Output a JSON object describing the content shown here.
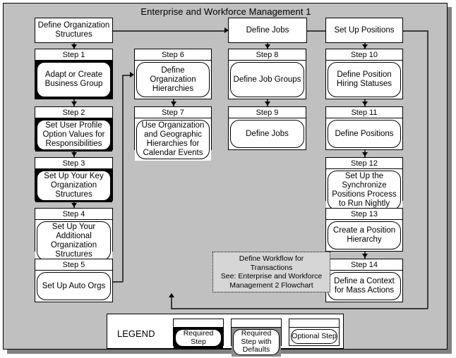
{
  "diagram": {
    "title": "Enterprise and Workforce Management 1",
    "top_row": [
      {
        "id": "define-org-structures",
        "label": "Define Organization Structures"
      },
      {
        "id": "define-jobs",
        "label": "Define Jobs"
      },
      {
        "id": "set-up-positions",
        "label": "Set Up Positions"
      }
    ],
    "steps": [
      {
        "id": "step-1",
        "header": "Step 1",
        "label": "Adapt or Create Business Group",
        "style": "required"
      },
      {
        "id": "step-2",
        "header": "Step 2",
        "label": "Set User Profile Option Values for Responsibilities",
        "style": "required"
      },
      {
        "id": "step-3",
        "header": "Step 3",
        "label": "Set Up Your Key Organization Structures",
        "style": "required"
      },
      {
        "id": "step-4",
        "header": "Step 4",
        "label": "Set Up Your Additional Organization Structures",
        "style": "optional"
      },
      {
        "id": "step-5",
        "header": "Step 5",
        "label": "Set Up Auto Orgs",
        "style": "optional"
      },
      {
        "id": "step-6",
        "header": "Step 6",
        "label": "Define Organization Hierarchies",
        "style": "optional"
      },
      {
        "id": "step-7",
        "header": "Step 7",
        "label": "Use Organization and Geographic Hierarchies for Calendar Events",
        "style": "optional"
      },
      {
        "id": "step-8",
        "header": "Step 8",
        "label": "Define Job Groups",
        "style": "optional"
      },
      {
        "id": "step-9",
        "header": "Step 9",
        "label": "Define Jobs",
        "style": "optional"
      },
      {
        "id": "step-10",
        "header": "Step 10",
        "label": "Define Position Hiring Statuses",
        "style": "optional"
      },
      {
        "id": "step-11",
        "header": "Step 11",
        "label": "Define Positions",
        "style": "optional"
      },
      {
        "id": "step-12",
        "header": "Step 12",
        "label": "Set Up the Synchronize Positions Process to Run Nightly",
        "style": "optional"
      },
      {
        "id": "step-13",
        "header": "Step 13",
        "label": "Create a Position Hierarchy",
        "style": "optional"
      },
      {
        "id": "step-14",
        "header": "Step 14",
        "label": "Define a Context for Mass Actions",
        "style": "optional"
      }
    ],
    "note": {
      "id": "define-workflow-note",
      "line1": "Define Workflow for",
      "line2": "Transactions",
      "line3": "See: Enterprise and Workforce",
      "line4": "Management 2 Flowchart"
    },
    "legend": {
      "label": "LEGEND",
      "items": [
        {
          "id": "legend-required",
          "label": "Required Step",
          "style": "required"
        },
        {
          "id": "legend-required-defaults",
          "label": "Required Step with Defaults",
          "style": "defaults"
        },
        {
          "id": "legend-optional",
          "label": "Optional Step",
          "style": "optional"
        }
      ]
    },
    "colors": {
      "canvas": "#c0c0c0",
      "required_fill": "#000000",
      "defaults_fill": "#8c8c8c",
      "optional_fill": "#ffffff",
      "line": "#3a3a3a",
      "note_fill": "#d6d6d6",
      "shadow": "#808080"
    }
  }
}
